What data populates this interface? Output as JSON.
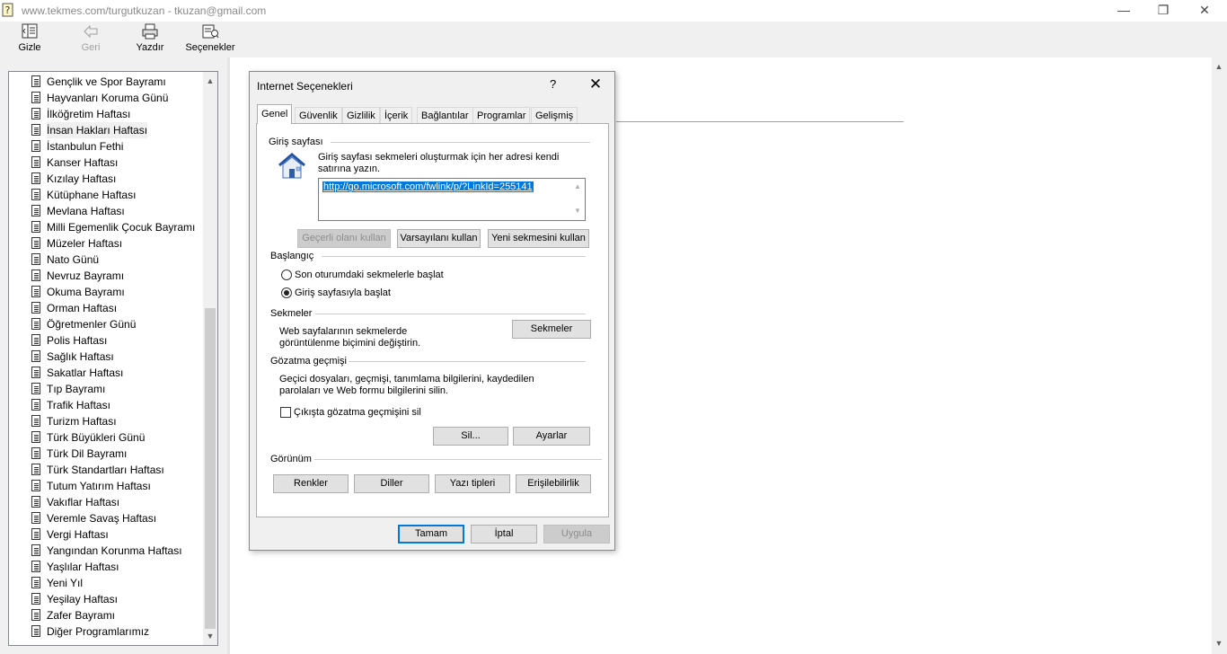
{
  "window": {
    "title": "www.tekmes.com/turgutkuzan - tkuzan@gmail.com",
    "minimize_glyph": "—",
    "restore_glyph": "❐",
    "close_glyph": "✕"
  },
  "toolbar": {
    "hide_label": "Gizle",
    "back_label": "Geri",
    "print_label": "Yazdır",
    "options_label": "Seçenekler"
  },
  "tree": {
    "items": [
      "Gençlik ve Spor Bayramı",
      "Hayvanları Koruma Günü",
      "İlköğretim Haftası",
      "İnsan Hakları Haftası",
      "İstanbulun Fethi",
      "Kanser Haftası",
      "Kızılay Haftası",
      "Kütüphane Haftası",
      "Mevlana Haftası",
      "Milli Egemenlik Çocuk Bayramı",
      "Müzeler Haftası",
      "Nato Günü",
      "Nevruz Bayramı",
      "Okuma Bayramı",
      "Orman Haftası",
      "Öğretmenler Günü",
      "Polis Haftası",
      "Sağlık Haftası",
      "Sakatlar Haftası",
      "Tıp Bayramı",
      "Trafik Haftası",
      "Turizm Haftası",
      "Türk Büyükleri Günü",
      "Türk Dil Bayramı",
      "Türk Standartları Haftası",
      "Tutum Yatırım Haftası",
      "Vakıflar Haftası",
      "Veremle Savaş Haftası",
      "Vergi Haftası",
      "Yangından Korunma Haftası",
      "Yaşlılar Haftası",
      "Yeni Yıl",
      "Yeşilay Haftası",
      "Zafer Bayramı",
      "Diğer Programlarımız"
    ],
    "selected_index": 3
  },
  "dialog": {
    "title": "Internet Seçenekleri",
    "help": "?",
    "close": "✕",
    "tabs": [
      "Genel",
      "Güvenlik",
      "Gizlilik",
      "İçerik",
      "Bağlantılar",
      "Programlar",
      "Gelişmiş"
    ],
    "homepage": {
      "group": "Giriş sayfası",
      "description": "Giriş sayfası sekmeleri oluşturmak için her adresi kendi satırına yazın.",
      "url": "http://go.microsoft.com/fwlink/p/?LinkId=255141",
      "use_current": "Geçerli olanı kullan",
      "use_default": "Varsayılanı kullan",
      "use_new_tab": "Yeni sekmesini kullan"
    },
    "startup": {
      "group": "Başlangıç",
      "option_last_session": "Son oturumdaki sekmelerle başlat",
      "option_homepage": "Giriş sayfasıyla başlat",
      "selected": "homepage"
    },
    "tabs_group": {
      "group": "Sekmeler",
      "description": "Web sayfalarının sekmelerde görüntülenme biçimini değiştirin.",
      "button": "Sekmeler"
    },
    "history": {
      "group": "Gözatma geçmişi",
      "description": "Geçici dosyaları, geçmişi, tanımlama bilgilerini, kaydedilen parolaları ve Web formu bilgilerini silin.",
      "delete_on_exit": "Çıkışta gözatma geçmişini sil",
      "delete_on_exit_checked": false,
      "delete": "Sil...",
      "settings": "Ayarlar"
    },
    "appearance": {
      "group": "Görünüm",
      "colors": "Renkler",
      "languages": "Diller",
      "fonts": "Yazı tipleri",
      "accessibility": "Erişilebilirlik"
    },
    "footer": {
      "ok": "Tamam",
      "cancel": "İptal",
      "apply": "Uygula"
    }
  }
}
